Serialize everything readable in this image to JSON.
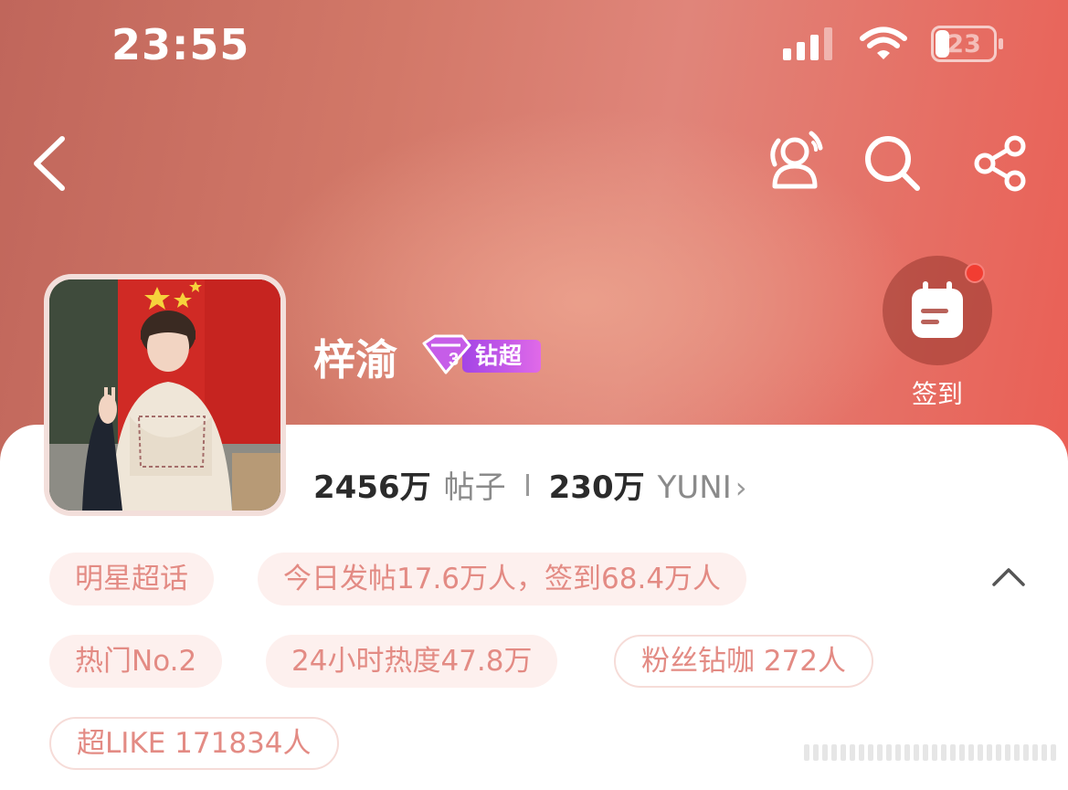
{
  "status_bar": {
    "time": "23:55",
    "battery_level": "23",
    "battery_fraction": 0.23
  },
  "nav": {
    "back_icon": "chevron-left-icon",
    "fans_icon": "fans-broadcast-icon",
    "search_icon": "search-icon",
    "share_icon": "share-icon"
  },
  "profile": {
    "name": "梓渝",
    "badge_text": "钻超",
    "badge_level": "3",
    "avatar_icon": "avatar-photo"
  },
  "checkin": {
    "label": "签到",
    "icon": "calendar-icon"
  },
  "stats": {
    "posts_value": "2456万",
    "posts_label": "帖子",
    "fans_value": "230万",
    "fans_label": "YUNI",
    "chevron": "›"
  },
  "tags": [
    {
      "label": "明星超话"
    },
    {
      "label": "今日发帖17.6万人，签到68.4万人"
    },
    {
      "label": "热门No.2"
    },
    {
      "label": "24小时热度47.8万"
    },
    {
      "label": "粉丝钻咖 272人"
    },
    {
      "label": "超LIKE 171834人"
    }
  ],
  "colors": {
    "hero_left": "#c0665b",
    "hero_right": "#ea5f55",
    "tag_text": "#e38b84",
    "tag_bg": "#fdf0ee",
    "badge": "#b845e0"
  }
}
